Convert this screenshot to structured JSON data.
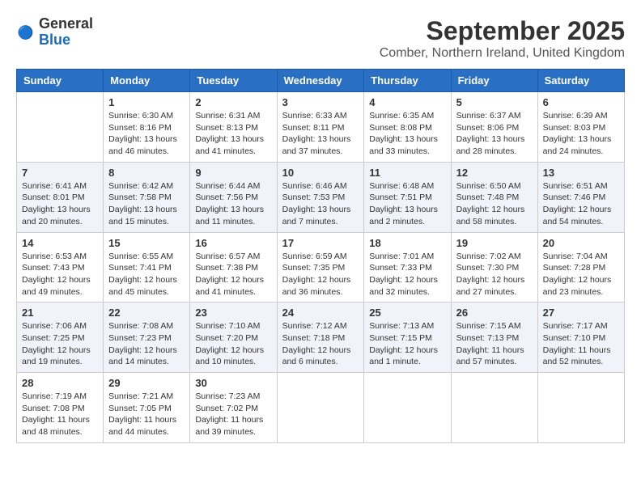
{
  "logo": {
    "general": "General",
    "blue": "Blue"
  },
  "header": {
    "month": "September 2025",
    "location": "Comber, Northern Ireland, United Kingdom"
  },
  "days_of_week": [
    "Sunday",
    "Monday",
    "Tuesday",
    "Wednesday",
    "Thursday",
    "Friday",
    "Saturday"
  ],
  "weeks": [
    [
      null,
      {
        "day": "1",
        "sunrise": "6:30 AM",
        "sunset": "8:16 PM",
        "daylight": "13 hours and 46 minutes."
      },
      {
        "day": "2",
        "sunrise": "6:31 AM",
        "sunset": "8:13 PM",
        "daylight": "13 hours and 41 minutes."
      },
      {
        "day": "3",
        "sunrise": "6:33 AM",
        "sunset": "8:11 PM",
        "daylight": "13 hours and 37 minutes."
      },
      {
        "day": "4",
        "sunrise": "6:35 AM",
        "sunset": "8:08 PM",
        "daylight": "13 hours and 33 minutes."
      },
      {
        "day": "5",
        "sunrise": "6:37 AM",
        "sunset": "8:06 PM",
        "daylight": "13 hours and 28 minutes."
      },
      {
        "day": "6",
        "sunrise": "6:39 AM",
        "sunset": "8:03 PM",
        "daylight": "13 hours and 24 minutes."
      }
    ],
    [
      {
        "day": "7",
        "sunrise": "6:41 AM",
        "sunset": "8:01 PM",
        "daylight": "13 hours and 20 minutes."
      },
      {
        "day": "8",
        "sunrise": "6:42 AM",
        "sunset": "7:58 PM",
        "daylight": "13 hours and 15 minutes."
      },
      {
        "day": "9",
        "sunrise": "6:44 AM",
        "sunset": "7:56 PM",
        "daylight": "13 hours and 11 minutes."
      },
      {
        "day": "10",
        "sunrise": "6:46 AM",
        "sunset": "7:53 PM",
        "daylight": "13 hours and 7 minutes."
      },
      {
        "day": "11",
        "sunrise": "6:48 AM",
        "sunset": "7:51 PM",
        "daylight": "13 hours and 2 minutes."
      },
      {
        "day": "12",
        "sunrise": "6:50 AM",
        "sunset": "7:48 PM",
        "daylight": "12 hours and 58 minutes."
      },
      {
        "day": "13",
        "sunrise": "6:51 AM",
        "sunset": "7:46 PM",
        "daylight": "12 hours and 54 minutes."
      }
    ],
    [
      {
        "day": "14",
        "sunrise": "6:53 AM",
        "sunset": "7:43 PM",
        "daylight": "12 hours and 49 minutes."
      },
      {
        "day": "15",
        "sunrise": "6:55 AM",
        "sunset": "7:41 PM",
        "daylight": "12 hours and 45 minutes."
      },
      {
        "day": "16",
        "sunrise": "6:57 AM",
        "sunset": "7:38 PM",
        "daylight": "12 hours and 41 minutes."
      },
      {
        "day": "17",
        "sunrise": "6:59 AM",
        "sunset": "7:35 PM",
        "daylight": "12 hours and 36 minutes."
      },
      {
        "day": "18",
        "sunrise": "7:01 AM",
        "sunset": "7:33 PM",
        "daylight": "12 hours and 32 minutes."
      },
      {
        "day": "19",
        "sunrise": "7:02 AM",
        "sunset": "7:30 PM",
        "daylight": "12 hours and 27 minutes."
      },
      {
        "day": "20",
        "sunrise": "7:04 AM",
        "sunset": "7:28 PM",
        "daylight": "12 hours and 23 minutes."
      }
    ],
    [
      {
        "day": "21",
        "sunrise": "7:06 AM",
        "sunset": "7:25 PM",
        "daylight": "12 hours and 19 minutes."
      },
      {
        "day": "22",
        "sunrise": "7:08 AM",
        "sunset": "7:23 PM",
        "daylight": "12 hours and 14 minutes."
      },
      {
        "day": "23",
        "sunrise": "7:10 AM",
        "sunset": "7:20 PM",
        "daylight": "12 hours and 10 minutes."
      },
      {
        "day": "24",
        "sunrise": "7:12 AM",
        "sunset": "7:18 PM",
        "daylight": "12 hours and 6 minutes."
      },
      {
        "day": "25",
        "sunrise": "7:13 AM",
        "sunset": "7:15 PM",
        "daylight": "12 hours and 1 minute."
      },
      {
        "day": "26",
        "sunrise": "7:15 AM",
        "sunset": "7:13 PM",
        "daylight": "11 hours and 57 minutes."
      },
      {
        "day": "27",
        "sunrise": "7:17 AM",
        "sunset": "7:10 PM",
        "daylight": "11 hours and 52 minutes."
      }
    ],
    [
      {
        "day": "28",
        "sunrise": "7:19 AM",
        "sunset": "7:08 PM",
        "daylight": "11 hours and 48 minutes."
      },
      {
        "day": "29",
        "sunrise": "7:21 AM",
        "sunset": "7:05 PM",
        "daylight": "11 hours and 44 minutes."
      },
      {
        "day": "30",
        "sunrise": "7:23 AM",
        "sunset": "7:02 PM",
        "daylight": "11 hours and 39 minutes."
      },
      null,
      null,
      null,
      null
    ]
  ]
}
